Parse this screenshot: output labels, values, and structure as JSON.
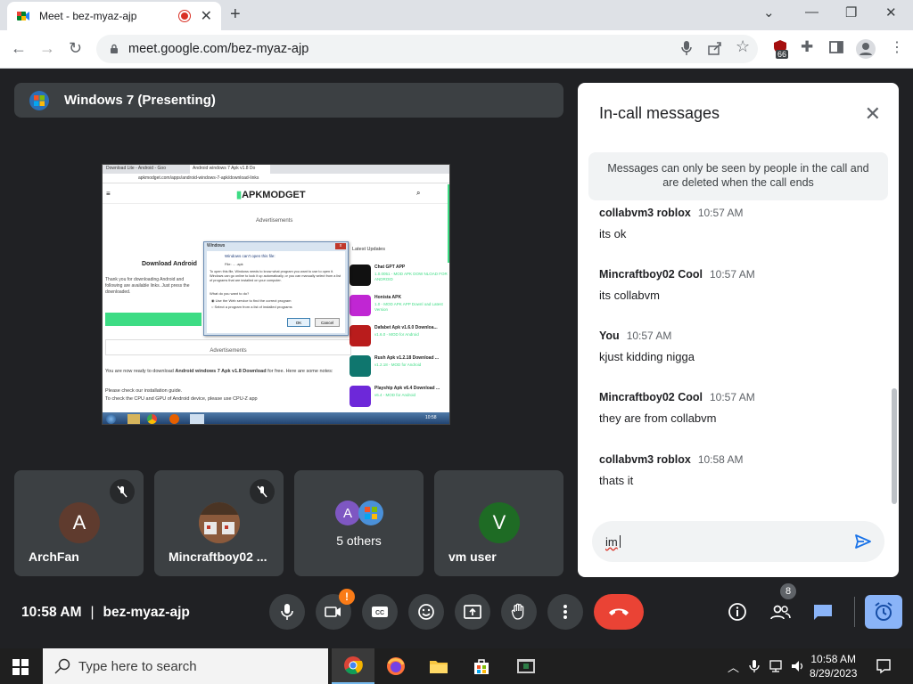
{
  "browser": {
    "tab_title": "Meet - bez-myaz-ajp",
    "url": "meet.google.com/bez-myaz-ajp",
    "extension_badge": "66"
  },
  "meet": {
    "presenting_label": "Windows 7 (Presenting)",
    "tiles": [
      {
        "name": "ArchFan",
        "initial": "A",
        "color": "#5f3b2e",
        "muted": true
      },
      {
        "name": "Mincraftboy02 ...",
        "muted": true
      },
      {
        "name": "5 others",
        "initial": "A"
      },
      {
        "name": "vm user",
        "initial": "V",
        "color": "#1e6b24"
      }
    ],
    "time": "10:58 AM",
    "separator": "|",
    "meeting_code": "bez-myaz-ajp",
    "camera_warning": "!",
    "participants_count": "8"
  },
  "chat": {
    "title": "In-call messages",
    "notice": "Messages can only be seen by people in the call and are deleted when the call ends",
    "messages": [
      {
        "sender": "collabvm3 roblox",
        "time": "10:57 AM",
        "text": "its ok"
      },
      {
        "sender": "Mincraftboy02 Cool",
        "time": "10:57 AM",
        "text": "its collabvm"
      },
      {
        "sender": "You",
        "time": "10:57 AM",
        "text": "kjust kidding nigga"
      },
      {
        "sender": "Mincraftboy02 Cool",
        "time": "10:57 AM",
        "text": "they are from collabvm"
      },
      {
        "sender": "collabvm3 roblox",
        "time": "10:58 AM",
        "text": "thats it"
      }
    ],
    "input_value": "im"
  },
  "shared_screen": {
    "tab1": "Download Lite - Android - Goo",
    "tab2": "Android windows 7 Apk v1.8 Do",
    "url": "apkmodget.com/apps/android-windows-7-apk/download-links",
    "site_logo": "APKMODGET",
    "ads_label": "Advertisements",
    "heading": "Download Android",
    "body1": "Thank you for downloading Android and following are available links. Just press the downloaded.",
    "ads_label2": "Advertisements",
    "body2_prefix": "You are now ready to download ",
    "body2_bold": "Android windows 7 Apk v1.8 Download",
    "body2_suffix": " for free. Here are some notes:",
    "body3": "Please check our installation guide.",
    "body4": "To check the CPU and GPU of Android device, please use CPU-Z app",
    "sidebar_title": "Latest Updates",
    "sidebar_items": [
      {
        "title": "Chat GPT APP",
        "sub": "1.0.0051 - MOD APK DOW NLOAD FOR ANDROID",
        "color": "#111111"
      },
      {
        "title": "Honista APK",
        "sub": "1.0 - MOD APK APP Downl oad Latest Version",
        "color": "#c026d3"
      },
      {
        "title": "Dafabet Apk v1.6.0 Downloa...",
        "sub": "v1.6.0 - MOD for Android",
        "color": "#b91c1c"
      },
      {
        "title": "Rush Apk v1.2.18 Download ...",
        "sub": "v1.2.18 - MOD for Android",
        "color": "#0f766e"
      },
      {
        "title": "Playship Apk v6.4 Download ...",
        "sub": "v6.4 - MOD for Android",
        "color": "#6d28d9"
      }
    ],
    "dialog_title": "Windows",
    "dialog_line1": "Windows can't open this file:",
    "dialog_line2": "File: ... .apk",
    "dialog_body": "To open this file, Windows needs to know what program you want to use to open it. Windows can go online to look it up automatically, or you can manually select from a list of programs that are installed on your computer.",
    "dialog_question": "What do you want to do?",
    "dialog_opt1": "Use the Web service to find the correct program",
    "dialog_opt2": "Select a program from a list of installed programs",
    "dialog_ok": "OK",
    "dialog_cancel": "Cancel",
    "taskbar_time": "10:58"
  },
  "taskbar": {
    "search_placeholder": "Type here to search",
    "time": "10:58 AM",
    "date": "8/29/2023"
  }
}
